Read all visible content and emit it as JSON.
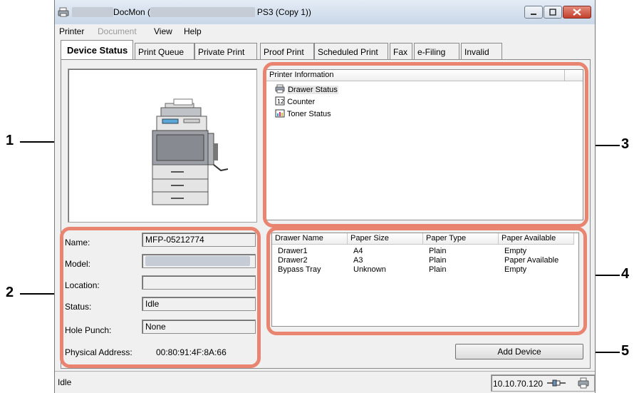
{
  "window": {
    "title_prefix": "TopAccessDocMon (",
    "title_model": "TOSHIBA e-STUDIO4520C",
    "title_suffix": " PS3 (Copy 1))",
    "title_blur_left": "TopAccess",
    "title_blur_mid": "TOSHIBA e-STUDIO4520C",
    "title_visible_a": "DocMon (",
    "title_visible_b": "PS3 (Copy 1))"
  },
  "menu": {
    "items": [
      {
        "label": "Printer",
        "enabled": true
      },
      {
        "label": "Document",
        "enabled": false
      },
      {
        "label": "View",
        "enabled": true
      },
      {
        "label": "Help",
        "enabled": true
      }
    ]
  },
  "tabs": [
    {
      "label": "Device Status",
      "active": true
    },
    {
      "label": "Print Queue"
    },
    {
      "label": "Private Print"
    },
    {
      "label": "Proof Print"
    },
    {
      "label": "Scheduled Print"
    },
    {
      "label": "Fax"
    },
    {
      "label": "e-Filing"
    },
    {
      "label": "Invalid"
    }
  ],
  "device_info": {
    "name_label": "Name:",
    "name_value": "MFP-05212774",
    "model_label": "Model:",
    "model_value": "TOSHIBA e-STUDIO4520C",
    "location_label": "Location:",
    "location_value": "",
    "status_label": "Status:",
    "status_value": "Idle",
    "hole_punch_label": "Hole Punch:",
    "hole_punch_value": "None",
    "physical_address_label": "Physical Address:",
    "physical_address_value": "00:80:91:4F:8A:66"
  },
  "printer_information": {
    "header": "Printer Information",
    "items": [
      {
        "label": "Drawer Status",
        "icon": "drawer-icon",
        "selected": true
      },
      {
        "label": "Counter",
        "icon": "counter-icon"
      },
      {
        "label": "Toner Status",
        "icon": "toner-icon"
      }
    ]
  },
  "drawer_table": {
    "columns": [
      "Drawer Name",
      "Paper Size",
      "Paper Type",
      "Paper Available"
    ],
    "rows": [
      [
        "Drawer1",
        "A4",
        "Plain",
        "Empty"
      ],
      [
        "Drawer2",
        "A3",
        "Plain",
        "Paper Available"
      ],
      [
        "Bypass Tray",
        "Unknown",
        "Plain",
        "Empty"
      ]
    ]
  },
  "add_device_button": "Add Device",
  "status_bar": {
    "status": "Idle",
    "ip": "10.10.70.120"
  },
  "callouts": [
    "1",
    "2",
    "3",
    "4",
    "5"
  ],
  "colors": {
    "callout": "#e8846f",
    "titlebar": "#c9d7e8",
    "close_button": "#c2412c"
  }
}
